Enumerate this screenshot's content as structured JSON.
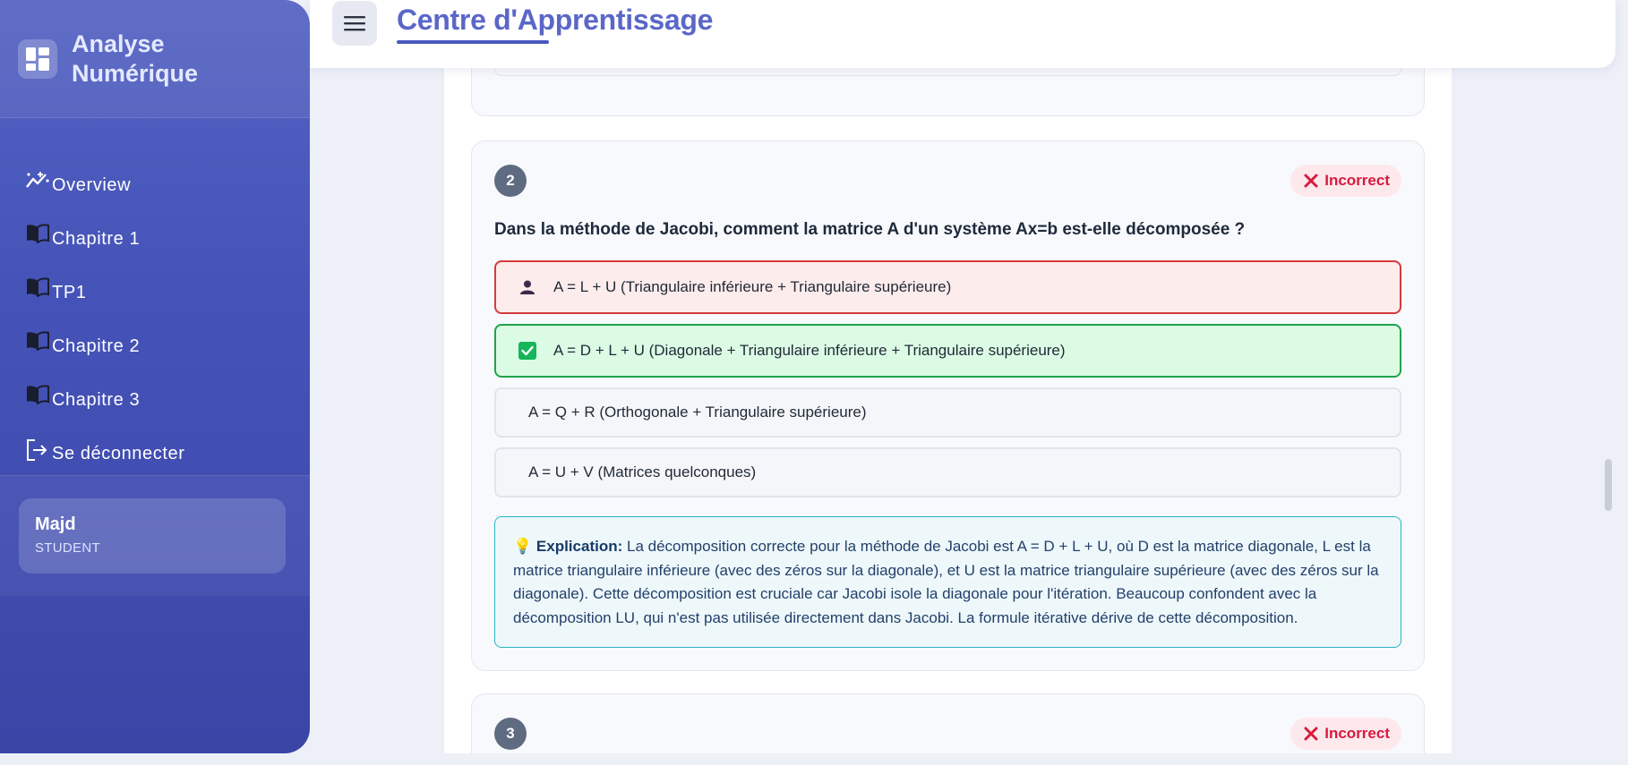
{
  "sidebar": {
    "brand": {
      "line1": "Analyse",
      "line2": "Numérique",
      "icon": "dashboard-icon"
    },
    "items": [
      {
        "label": "Overview",
        "icon": "analytics-icon"
      },
      {
        "label": "Chapitre 1",
        "icon": "book-icon"
      },
      {
        "label": "TP1",
        "icon": "book-icon"
      },
      {
        "label": "Chapitre 2",
        "icon": "book-icon"
      },
      {
        "label": "Chapitre 3",
        "icon": "book-icon"
      },
      {
        "label": "Se déconnecter",
        "icon": "logout-icon"
      }
    ],
    "user": {
      "name": "Majd",
      "role": "STUDENT"
    }
  },
  "header": {
    "title": "Centre d'Apprentissage",
    "menu_icon": "hamburger-menu-icon"
  },
  "questions": [
    {
      "number": "2",
      "status": "Incorrect",
      "text": "Dans la méthode de Jacobi, comment la matrice A d'un système Ax=b est-elle décomposée ?",
      "options": [
        {
          "text": "A = L + U (Triangulaire inférieure + Triangulaire supérieure)",
          "state": "selected-wrong"
        },
        {
          "text": "A = D + L + U (Diagonale + Triangulaire inférieure + Triangulaire supérieure)",
          "state": "correct"
        },
        {
          "text": "A = Q + R (Orthogonale + Triangulaire supérieure)",
          "state": "neutral"
        },
        {
          "text": "A = U + V (Matrices quelconques)",
          "state": "neutral"
        }
      ],
      "explanation": {
        "icon": "💡",
        "label": "Explication:",
        "text": "La décomposition correcte pour la méthode de Jacobi est A = D + L + U, où D est la matrice diagonale, L est la matrice triangulaire inférieure (avec des zéros sur la diagonale), et U est la matrice triangulaire supérieure (avec des zéros sur la diagonale). Cette décomposition est cruciale car Jacobi isole la diagonale pour l'itération. Beaucoup confondent avec la décomposition LU, qui n'est pas utilisée directement dans Jacobi. La formule itérative dérive de cette décomposition."
      }
    },
    {
      "number": "3",
      "status": "Incorrect"
    }
  ],
  "colors": {
    "accent": "#4b58bf",
    "incorrect": "#d81b3f",
    "correct": "#1fa34a",
    "info": "#2bb3c0"
  }
}
